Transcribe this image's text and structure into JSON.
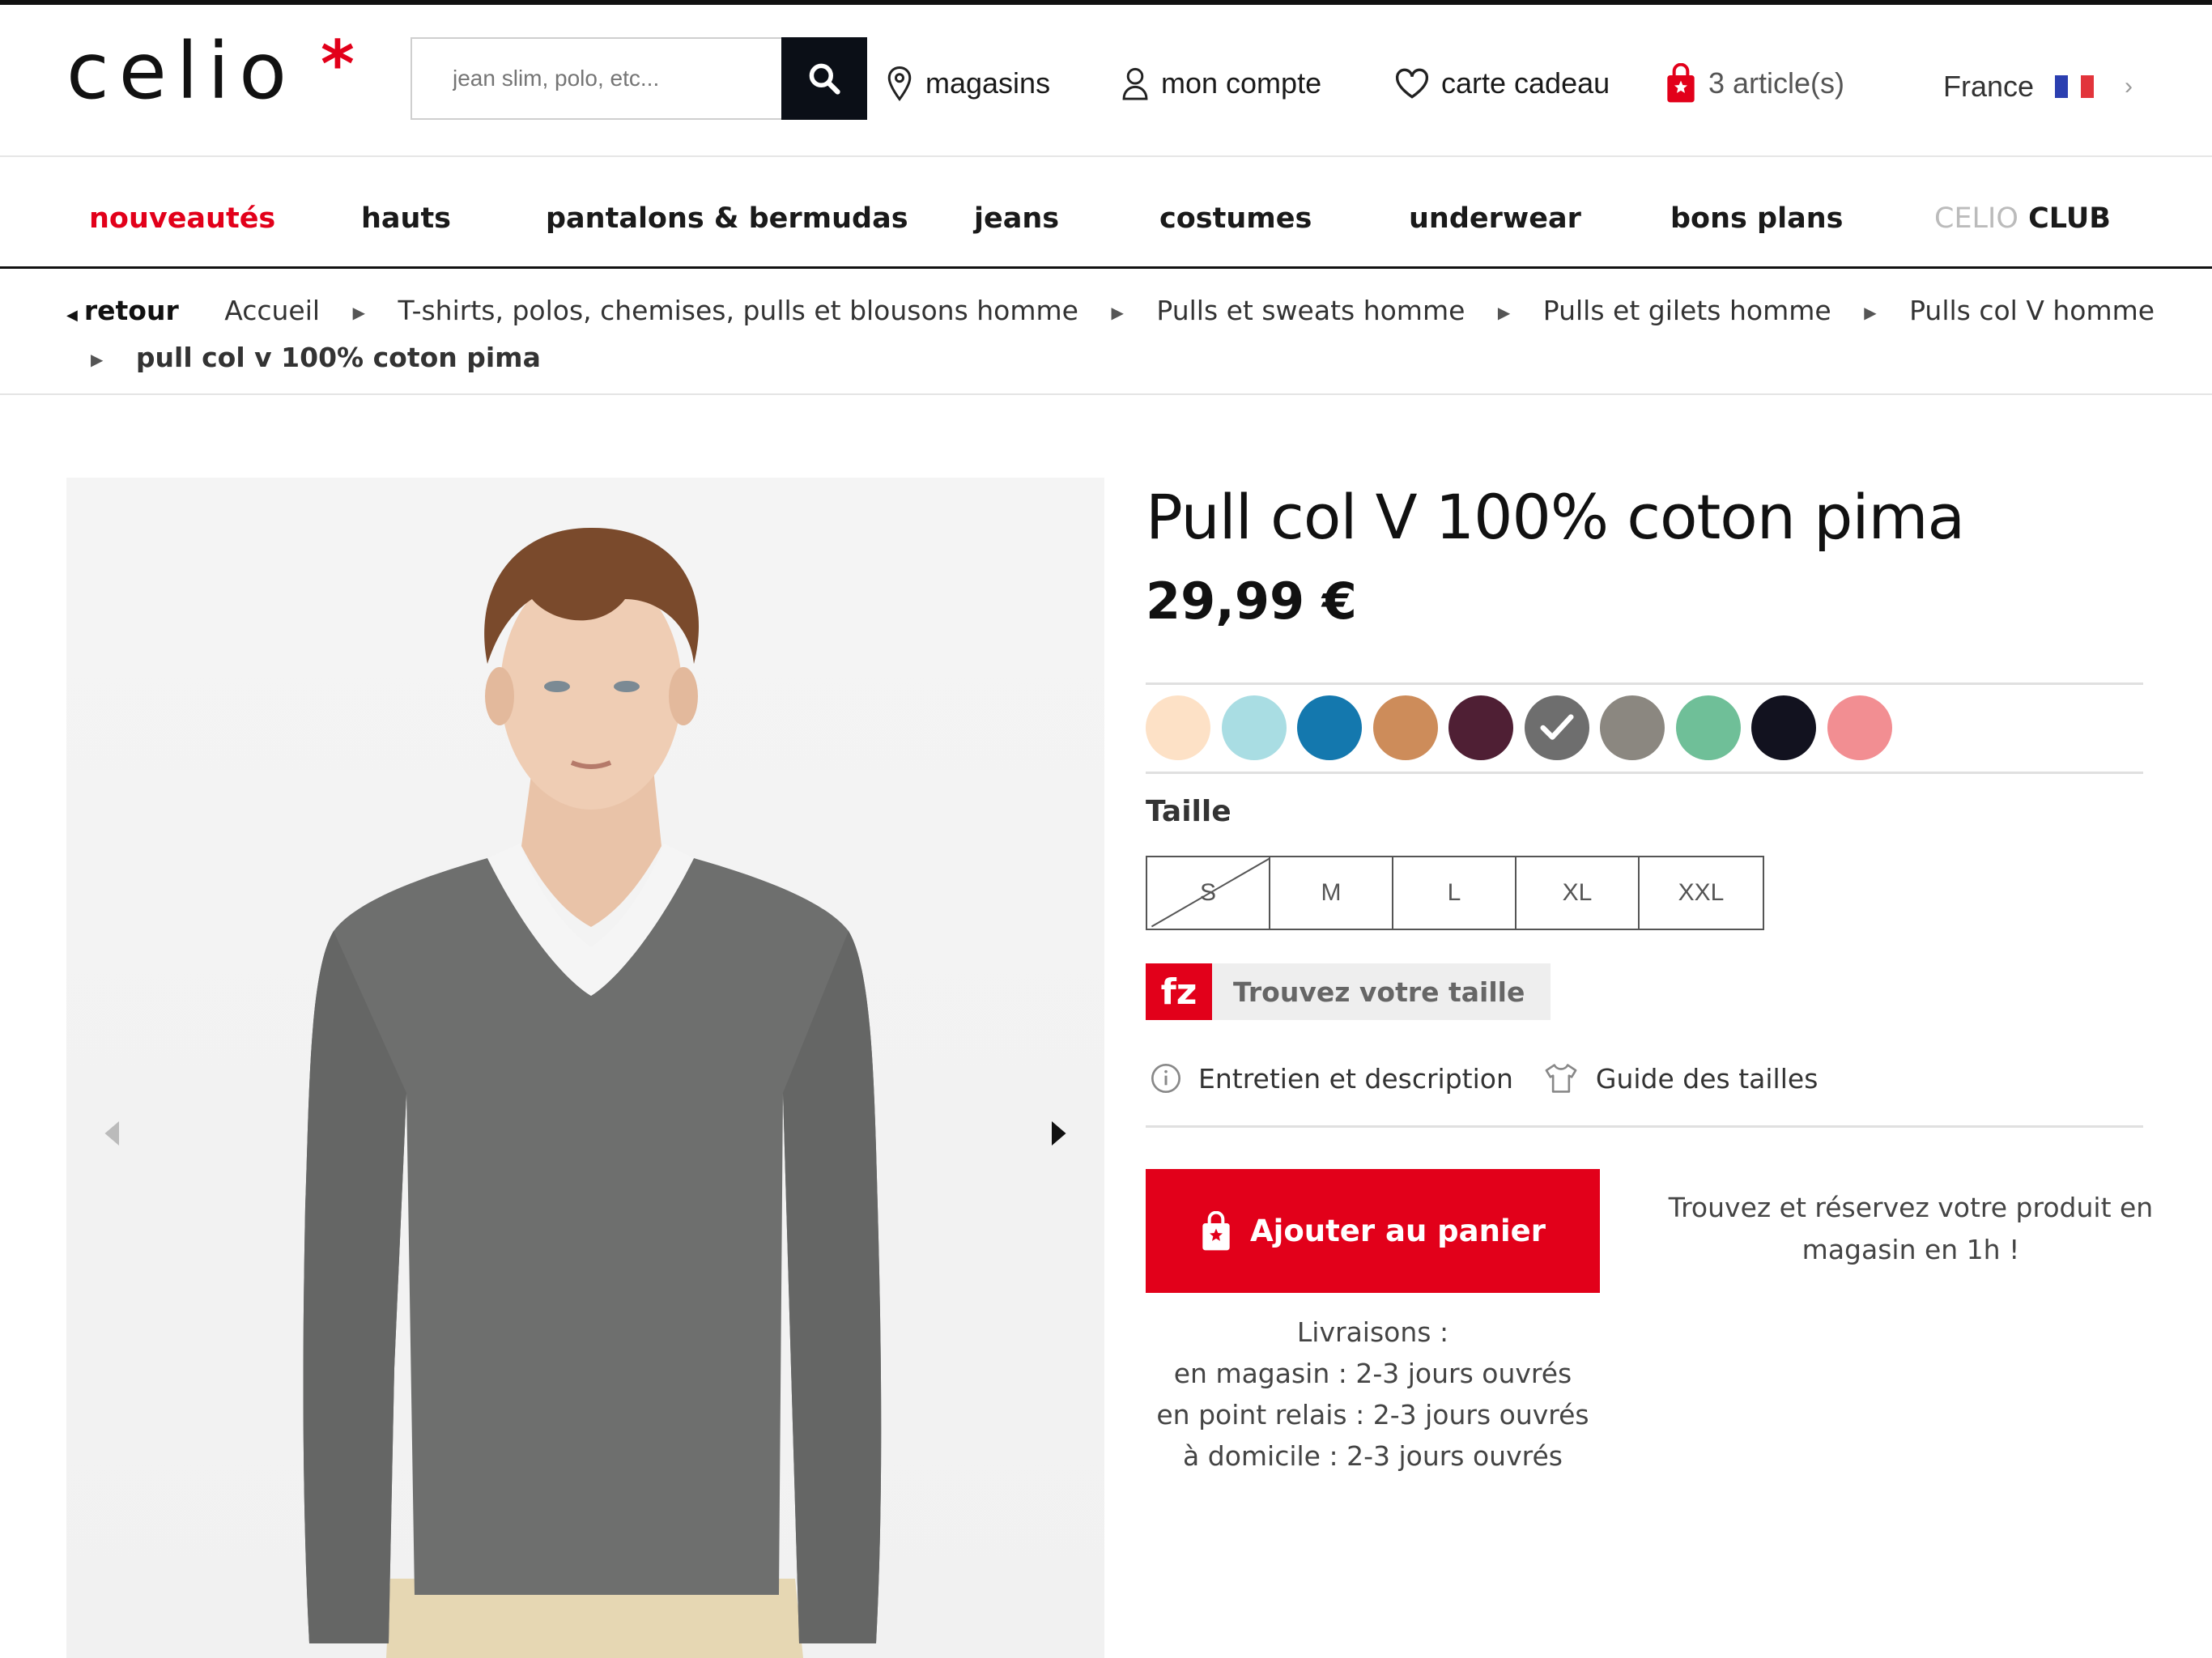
{
  "header": {
    "logo": "celio",
    "logo_mark": "*",
    "search_placeholder": "jean slim, polo, etc...",
    "links": {
      "stores": "magasins",
      "account": "mon compte",
      "gift_card": "carte cadeau",
      "cart": "3 article(s)"
    },
    "country": "France"
  },
  "nav": {
    "items": [
      "nouveautés",
      "hauts",
      "pantalons & bermudas",
      "jeans",
      "costumes",
      "underwear",
      "bons plans"
    ],
    "club_light": "CELIO",
    "club_bold": "CLUB"
  },
  "breadcrumb": {
    "back": "retour",
    "items": [
      "Accueil",
      "T-shirts, polos, chemises, pulls et blousons homme",
      "Pulls et sweats homme",
      "Pulls et gilets homme",
      "Pulls col V homme"
    ],
    "current": "pull col v 100% coton pima"
  },
  "product": {
    "title": "Pull col V 100% coton pima",
    "price": "29,99 €",
    "colors": [
      "#fde1c6",
      "#a9dde3",
      "#1478ae",
      "#cd8c5a",
      "#4f1f34",
      "#6e6e6e",
      "#8b8780",
      "#6fbf98",
      "#12121f",
      "#f28e92"
    ],
    "selected_color_index": 5,
    "size_label": "Taille",
    "sizes": [
      "S",
      "M",
      "L",
      "XL",
      "XXL"
    ],
    "unavailable_sizes": [
      "S"
    ],
    "fit_finder": "Trouvez votre taille",
    "fit_finder_logo": "fz",
    "care_link": "Entretien et description",
    "size_guide_link": "Guide des tailles",
    "add_to_cart": "Ajouter au panier",
    "reserve_text": "Trouvez et réservez votre produit en magasin en 1h !",
    "delivery": {
      "title": "Livraisons :",
      "store": "en magasin : 2-3 jours ouvrés",
      "relay": "en point relais : 2-3 jours ouvrés",
      "home": "à domicile : 2-3 jours ouvrés"
    }
  },
  "colors": {
    "brand_red": "#e2001a",
    "dark": "#0b0f17"
  }
}
